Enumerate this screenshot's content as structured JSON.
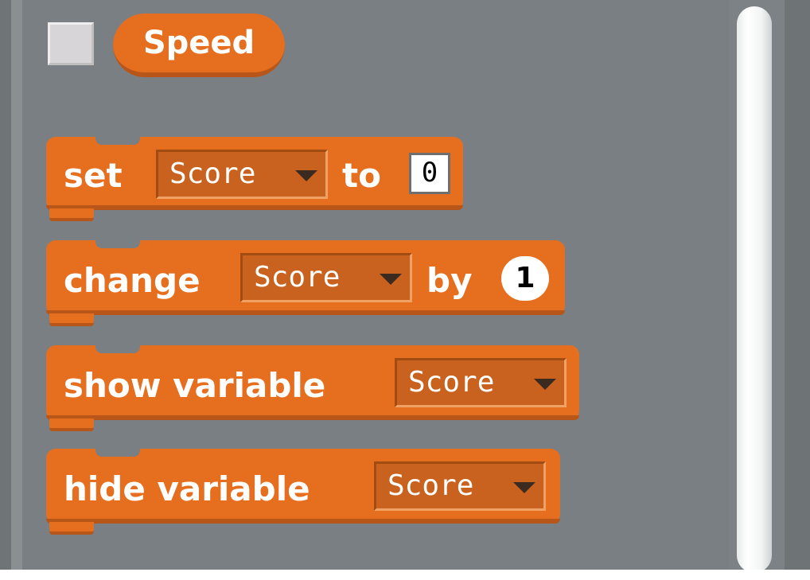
{
  "reporter": {
    "label": "Speed"
  },
  "blocks": {
    "set": {
      "word1": "set",
      "var": "Score",
      "word2": "to",
      "value": "0"
    },
    "change": {
      "word1": "change",
      "var": "Score",
      "word2": "by",
      "value": "1"
    },
    "show": {
      "word1": "show variable",
      "var": "Score"
    },
    "hide": {
      "word1": "hide variable",
      "var": "Score"
    }
  },
  "colors": {
    "block": "#e56f1f",
    "palette": "#7a7f83"
  },
  "icons": {
    "dropdown": "triangle-down-icon"
  }
}
